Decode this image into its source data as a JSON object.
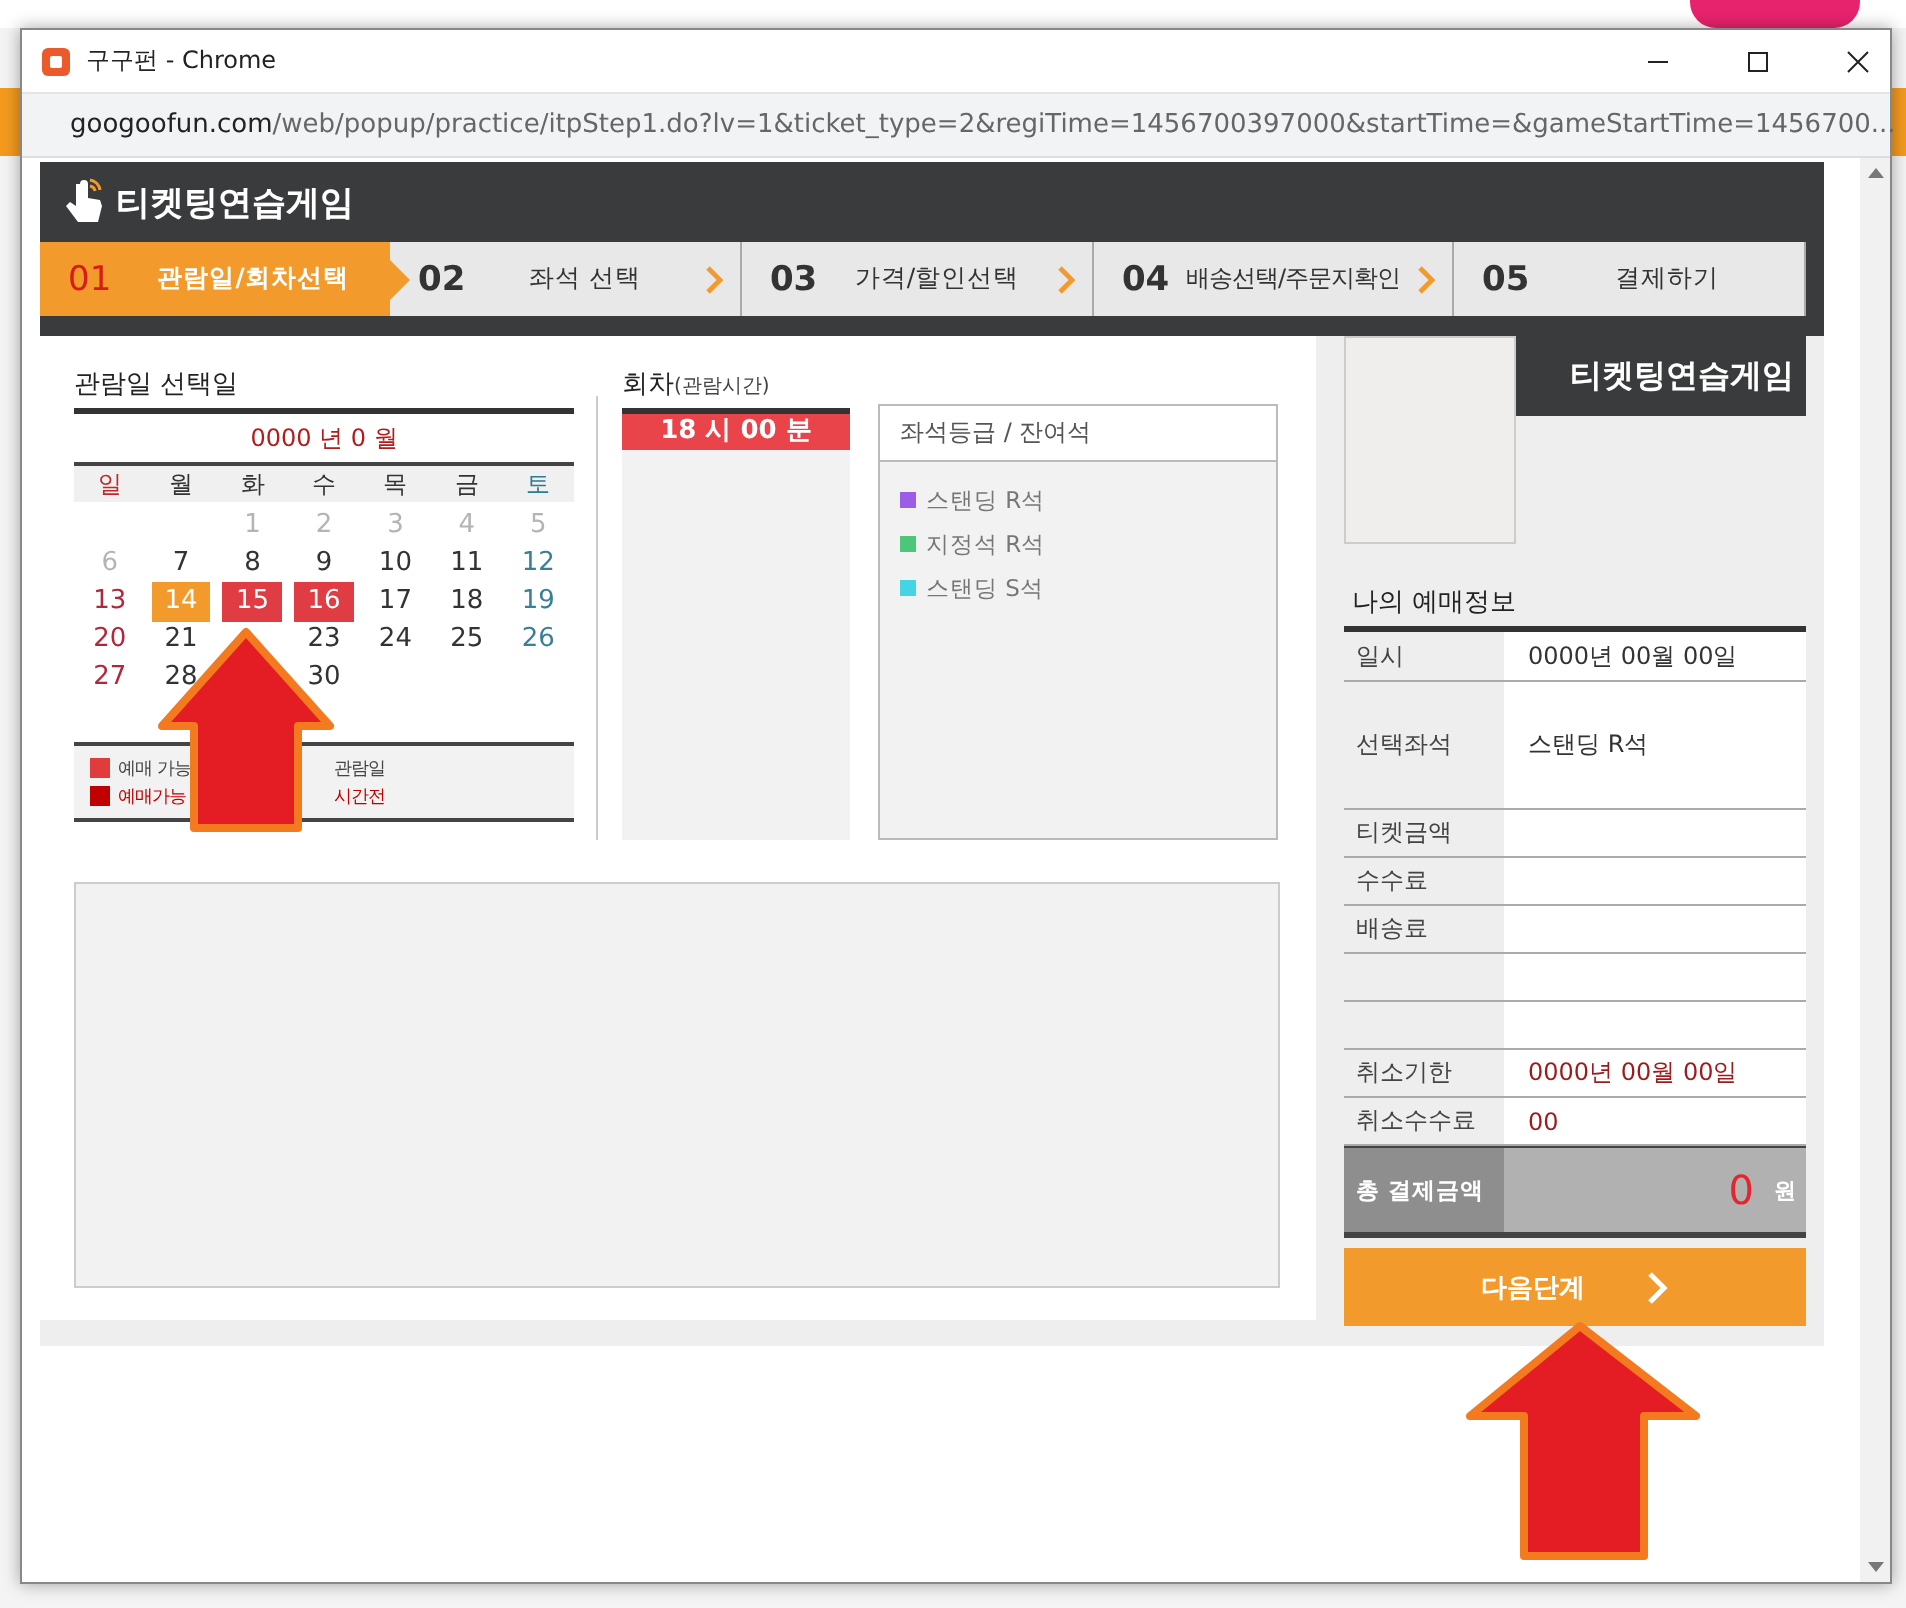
{
  "window": {
    "title": "구구펀 - Chrome"
  },
  "address_bar": {
    "host": "googoofun.com",
    "path": "/web/popup/practice/itpStep1.do?lv=1&ticket_type=2&regiTime=1456700397000&startTime=&gameStartTime=1456700..."
  },
  "page": {
    "title": "티켓팅연습게임",
    "side_title": "티켓팅연습게임"
  },
  "steps": [
    {
      "number": "01",
      "label": "관람일/회차선택",
      "selected": true,
      "chevron": false
    },
    {
      "number": "02",
      "label": "좌석 선택",
      "selected": false,
      "chevron": true
    },
    {
      "number": "03",
      "label": "가격/할인선택",
      "selected": false,
      "chevron": true
    },
    {
      "number": "04",
      "label": "배송선택/주문지확인",
      "selected": false,
      "chevron": true
    },
    {
      "number": "05",
      "label": "결제하기",
      "selected": false,
      "chevron": false
    }
  ],
  "calendar": {
    "title": "관람일 선택일",
    "month": "0000 년 0 월",
    "weekdays": [
      "일",
      "월",
      "화",
      "수",
      "목",
      "금",
      "토"
    ],
    "weeks": [
      {
        "kind": "first",
        "days": [
          {
            "day": "1",
            "kind": "past"
          },
          {
            "day": "2",
            "kind": "past"
          },
          {
            "day": "3",
            "kind": "past"
          },
          {
            "day": "4",
            "kind": "past"
          },
          {
            "day": "5",
            "kind": "past"
          }
        ]
      },
      {
        "kind": "full",
        "days": [
          {
            "day": "6",
            "kind": "past"
          },
          {
            "day": "7",
            "kind": "normal"
          },
          {
            "day": "8",
            "kind": "normal"
          },
          {
            "day": "9",
            "kind": "normal"
          },
          {
            "day": "10",
            "kind": "normal"
          },
          {
            "day": "11",
            "kind": "normal"
          },
          {
            "day": "12",
            "kind": "normal"
          }
        ]
      },
      {
        "kind": "full",
        "days": [
          {
            "day": "13",
            "kind": "normal"
          },
          {
            "day": "14",
            "kind": "selected"
          },
          {
            "day": "15",
            "kind": "available"
          },
          {
            "day": "16",
            "kind": "available"
          },
          {
            "day": "17",
            "kind": "normal"
          },
          {
            "day": "18",
            "kind": "normal"
          },
          {
            "day": "19",
            "kind": "normal"
          }
        ]
      },
      {
        "kind": "gapped",
        "days": [
          {
            "day": "20",
            "kind": "normal"
          },
          {
            "day": "21",
            "kind": "normal"
          },
          {
            "day": "23",
            "kind": "normal"
          },
          {
            "day": "24",
            "kind": "normal"
          },
          {
            "day": "25",
            "kind": "normal"
          },
          {
            "day": "26",
            "kind": "normal"
          }
        ]
      },
      {
        "kind": "gapped",
        "days": [
          {
            "day": "27",
            "kind": "normal"
          },
          {
            "day": "28",
            "kind": "normal"
          },
          {
            "day": "30",
            "kind": "normal"
          }
        ]
      }
    ],
    "legend": [
      {
        "color": "#e03c3c",
        "kind": "normal",
        "before": "예매 가능",
        "after": "관람일"
      },
      {
        "color": "#c00000",
        "kind": "warning",
        "before": "예매가능",
        "after": "시간전"
      }
    ]
  },
  "rounds": {
    "title": "회차",
    "subtitle": "(관람시간)",
    "items": [
      {
        "time": "18 시 00 분",
        "selected": true
      }
    ]
  },
  "seats": {
    "title": "좌석등급 / 잔여석",
    "items": [
      {
        "name": "스탠딩 R석",
        "color": "#9b5de5"
      },
      {
        "name": "지정석 R석",
        "color": "#4cc77a"
      },
      {
        "name": "스탠딩 S석",
        "color": "#44d4e4"
      }
    ]
  },
  "booking": {
    "title": "나의 예매정보",
    "rows": [
      {
        "kind": "normal",
        "label": "일시",
        "value": "0000년 00월 00일"
      },
      {
        "kind": "tall",
        "label": "선택좌석",
        "value": "스탠딩 R석"
      },
      {
        "kind": "normal",
        "label": "티켓금액"
      },
      {
        "kind": "normal",
        "label": "수수료"
      },
      {
        "kind": "normal",
        "label": "배송료"
      },
      {
        "kind": "blank"
      },
      {
        "kind": "blank"
      },
      {
        "kind": "warning",
        "label": "취소기한",
        "value": "0000년 00월 00일"
      },
      {
        "kind": "warning",
        "label": "취소수수료",
        "value": "00"
      }
    ],
    "total": {
      "label": "총 결제금액",
      "amount": "0",
      "unit": "원"
    }
  },
  "next_button": {
    "label": "다음단계"
  }
}
